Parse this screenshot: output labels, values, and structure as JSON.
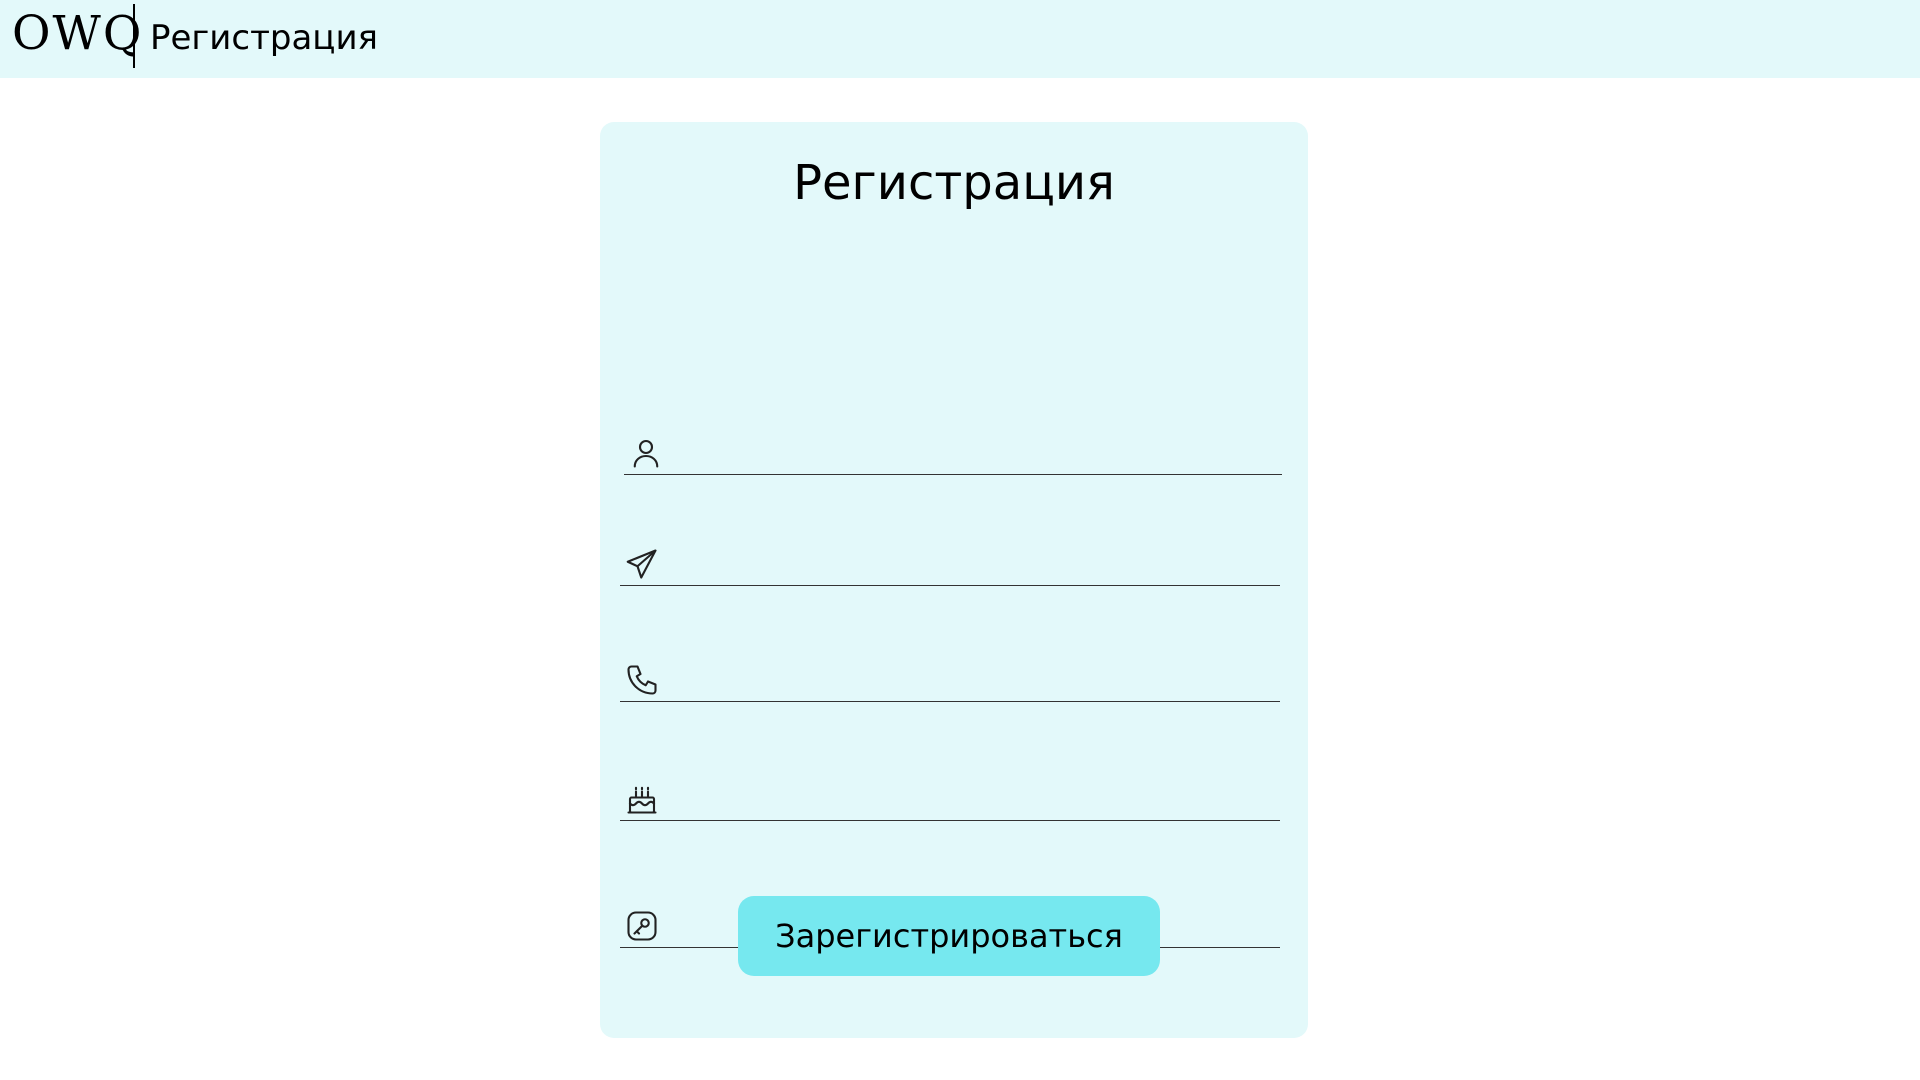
{
  "header": {
    "logo": "OWQ",
    "title": "Регистрация"
  },
  "form": {
    "title": "Регистрация",
    "fields": [
      {
        "icon": "user-icon",
        "value": "",
        "placeholder": ""
      },
      {
        "icon": "send-icon",
        "value": "",
        "placeholder": ""
      },
      {
        "icon": "phone-icon",
        "value": "",
        "placeholder": ""
      },
      {
        "icon": "birthday-cake-icon",
        "value": "",
        "placeholder": ""
      },
      {
        "icon": "key-icon",
        "value": "",
        "placeholder": ""
      }
    ],
    "submit_label": "Зарегистрироваться"
  },
  "colors": {
    "header_bg": "#e3f9fa",
    "card_bg": "#e3f9fa",
    "button_bg": "#76e8ef"
  }
}
